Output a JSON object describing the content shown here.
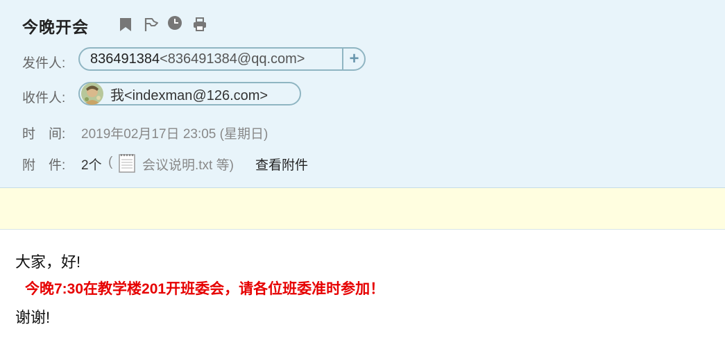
{
  "header": {
    "subject": "今晚开会",
    "toolbar": {
      "bookmark_icon": "bookmark-icon",
      "flag_icon": "flag-icon",
      "clock_icon": "clock-icon",
      "print_icon": "print-icon"
    },
    "sender": {
      "label": "发件人:",
      "name": "836491384",
      "address": "<836491384@qq.com>",
      "add_contact": "+"
    },
    "recipient": {
      "label": "收件人:",
      "text": "我<indexman@126.com>"
    },
    "time": {
      "label": "时　间:",
      "value": "2019年02月17日 23:05 (星期日)"
    },
    "attachments": {
      "label": "附　件:",
      "count": "2个",
      "open_paren": "(",
      "file": "会议说明.txt 等)",
      "view_link": "查看附件"
    }
  },
  "body": {
    "greeting": "大家，好!",
    "highlight": "今晚7:30在教学楼201开班委会，请各位班委准时参加！",
    "thanks": "谢谢!"
  },
  "colors": {
    "header_bg": "#e8f4fa",
    "notice_bg": "#fffee0",
    "chip_border": "#8fb5c2",
    "highlight_red": "#e60000"
  }
}
